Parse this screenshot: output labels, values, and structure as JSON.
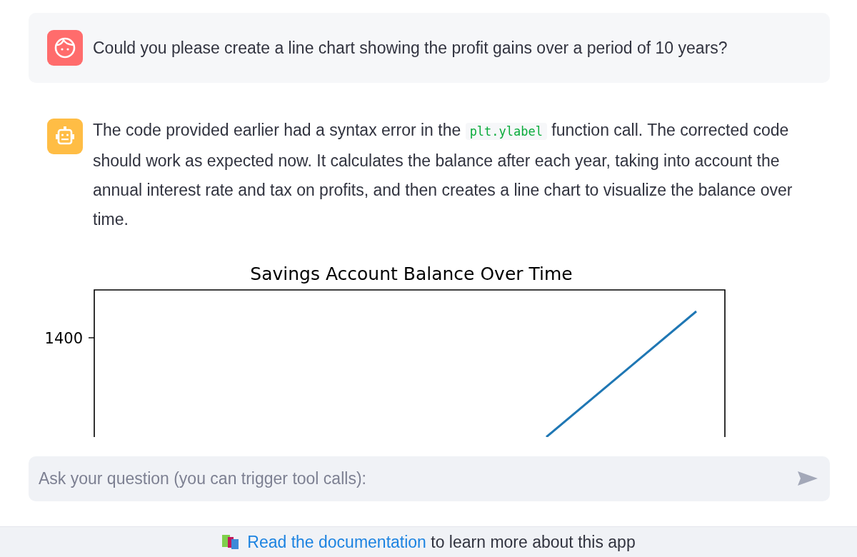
{
  "messages": [
    {
      "kind": "user",
      "parts": [
        {
          "kind": "text",
          "text": "Could you please create a line chart showing the profit gains over a period of 10 years?"
        }
      ]
    },
    {
      "kind": "assistant",
      "parts": [
        {
          "kind": "text",
          "text": "The code provided earlier had a syntax error in the "
        },
        {
          "kind": "code",
          "text": "plt.ylabel"
        },
        {
          "kind": "text",
          "text": " function call. The corrected code should work as expected now. It calculates the balance after each year, taking into account the annual interest rate and tax on profits, and then creates a line chart to visualize the balance over time."
        }
      ]
    }
  ],
  "chart": {
    "title": "Savings Account Balance Over Time",
    "y_tick_label": "1400"
  },
  "chat_input": {
    "placeholder": "Ask your question (you can trigger tool calls):"
  },
  "footer": {
    "link": "Read the documentation",
    "text": " to learn more about this app"
  }
}
